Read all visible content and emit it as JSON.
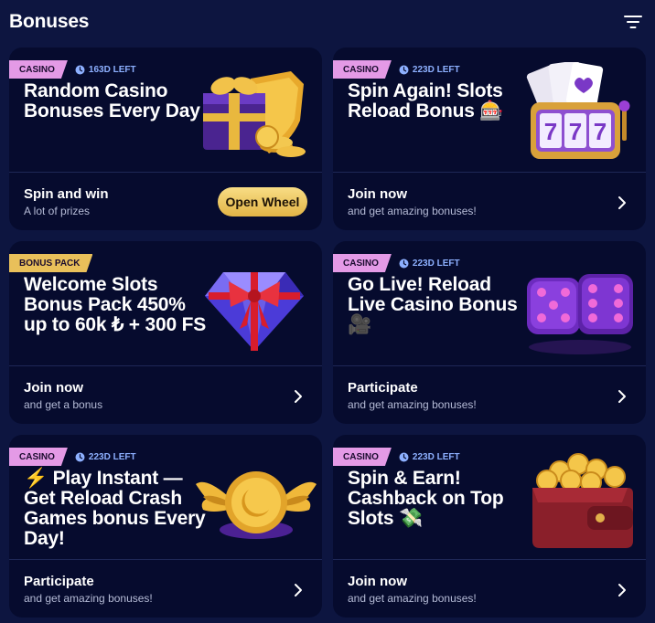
{
  "header": {
    "title": "Bonuses",
    "filter_icon": "filter-icon"
  },
  "colors": {
    "background": "#0d1540",
    "card": "#060b2e",
    "casino_tag": "#e49ae6",
    "pack_tag": "#e9c05a",
    "timer": "#8db0ff",
    "button": "#f0c85c"
  },
  "cards": [
    {
      "tag": "CASINO",
      "time_left": "163D LEFT",
      "title": "Random Casino Bonuses Every Day",
      "footer_title": "Spin and win",
      "footer_sub": "A lot of prizes",
      "button": "Open Wheel",
      "image": "gift-shield-coins"
    },
    {
      "tag": "CASINO",
      "time_left": "223D LEFT",
      "title": "Spin Again! Slots Reload Bonus 🎰",
      "footer_title": "Join now",
      "footer_sub": "and get amazing bonuses!",
      "image": "slot-machine-cards"
    },
    {
      "tag": "BONUS PACK",
      "time_left": "",
      "title": "Welcome Slots Bonus Pack 450% up to 60k ₺ + 300 FS",
      "footer_title": "Join now",
      "footer_sub": "and get a bonus",
      "image": "diamond-ribbon"
    },
    {
      "tag": "CASINO",
      "time_left": "223D LEFT",
      "title": "Go Live! Reload Live Casino Bonus 🎥",
      "footer_title": "Participate",
      "footer_sub": "and get amazing bonuses!",
      "image": "dice"
    },
    {
      "tag": "CASINO",
      "time_left": "223D LEFT",
      "title": "⚡ Play Instant — Get Reload Crash Games bonus Every Day!",
      "footer_title": "Participate",
      "footer_sub": "and get amazing bonuses!",
      "image": "winged-coin"
    },
    {
      "tag": "CASINO",
      "time_left": "223D LEFT",
      "title": "Spin & Earn! Cashback on Top Slots 💸",
      "footer_title": "Join now",
      "footer_sub": "and get amazing bonuses!",
      "image": "wallet-coins"
    }
  ]
}
